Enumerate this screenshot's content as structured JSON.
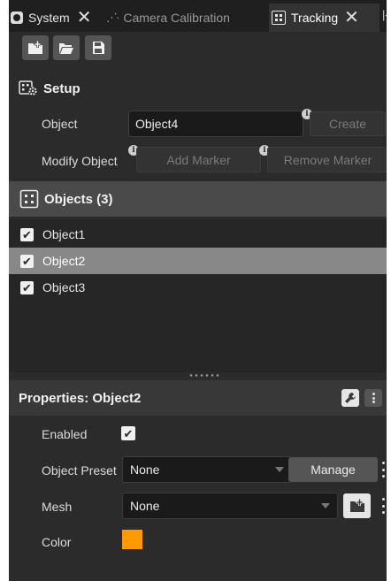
{
  "tabs": [
    {
      "label": "System",
      "icon": "system-icon"
    },
    {
      "label": "Camera Calibration",
      "icon": "camera-calibration-icon"
    },
    {
      "label": "Tracking",
      "icon": "tracking-icon",
      "active": true
    }
  ],
  "toolbar": {
    "buttons": [
      "new-file-icon",
      "open-folder-icon",
      "save-icon"
    ]
  },
  "setup": {
    "title": "Setup",
    "object_label": "Object",
    "object_value": "Object4",
    "create_label": "Create",
    "modify_label": "Modify Object",
    "add_marker_label": "Add Marker",
    "remove_marker_label": "Remove Marker"
  },
  "objects": {
    "title": "Objects (3)",
    "items": [
      {
        "name": "Object1",
        "checked": true,
        "selected": false
      },
      {
        "name": "Object2",
        "checked": true,
        "selected": true
      },
      {
        "name": "Object3",
        "checked": true,
        "selected": false
      }
    ]
  },
  "properties": {
    "title": "Properties: Object2",
    "enabled_label": "Enabled",
    "enabled": true,
    "preset_label": "Object Preset",
    "preset_value": "None",
    "manage_label": "Manage",
    "mesh_label": "Mesh",
    "mesh_value": "None",
    "color_label": "Color",
    "color_value": "#ff9a00"
  },
  "colors": {
    "panel_bg": "#2b2b2b",
    "selected_row": "#888888",
    "accent_swatch": "#ff9a00"
  }
}
